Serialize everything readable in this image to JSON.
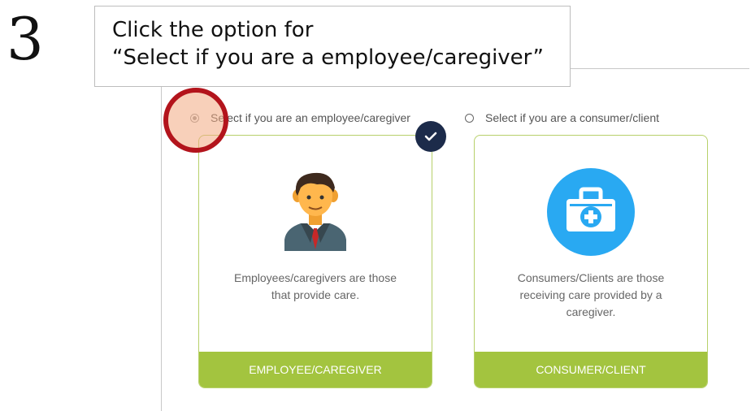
{
  "step_number": "3",
  "callout": {
    "line1": "Click the option for",
    "line2": "“Select if you are a employee/caregiver”"
  },
  "options": [
    {
      "radio_label": "Select if you are an employee/caregiver",
      "selected": true,
      "icon": "employee-person-icon",
      "description_line1": "Employees/caregivers are those",
      "description_line2": "that provide care.",
      "description_line3": "",
      "button_label": "EMPLOYEE/CAREGIVER"
    },
    {
      "radio_label": "Select if you are a consumer/client",
      "selected": false,
      "icon": "medical-kit-icon",
      "description_line1": "Consumers/Clients are those",
      "description_line2": "receiving care provided by a",
      "description_line3": "caregiver.",
      "button_label": "CONSUMER/CLIENT"
    }
  ],
  "colors": {
    "accent_green": "#a3c43f",
    "card_border": "#b7d06a",
    "badge_navy": "#1c2b4a",
    "highlight_red": "#b3141c",
    "icon_blue": "#29a9f2"
  }
}
